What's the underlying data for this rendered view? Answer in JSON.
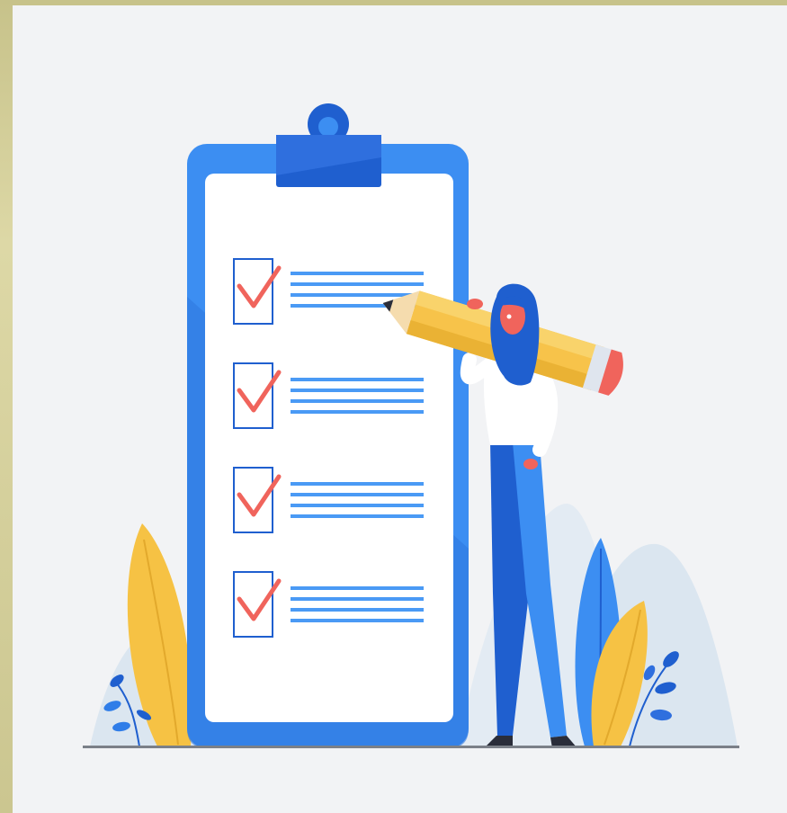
{
  "illustration": {
    "subject": "checklist-clipboard-with-woman-holding-pencil",
    "checklist_items": [
      {
        "checked": true,
        "line_count": 4
      },
      {
        "checked": true,
        "line_count": 4
      },
      {
        "checked": true,
        "line_count": 4
      },
      {
        "checked": true,
        "line_count": 4
      }
    ],
    "colors": {
      "background": "#f2f3f5",
      "frame": "#c9c58e",
      "clipboard_blue": "#3c8ef2",
      "clipboard_dark": "#1f5fcf",
      "paper": "#ffffff",
      "check_red": "#f0645c",
      "line_blue": "#4a9af5",
      "pencil_yellow": "#f7c34a",
      "leaf_yellow": "#f6c244",
      "leaf_blue": "#2f7de8",
      "hill": "#dbe6f0",
      "ground": "#7b8088"
    }
  }
}
